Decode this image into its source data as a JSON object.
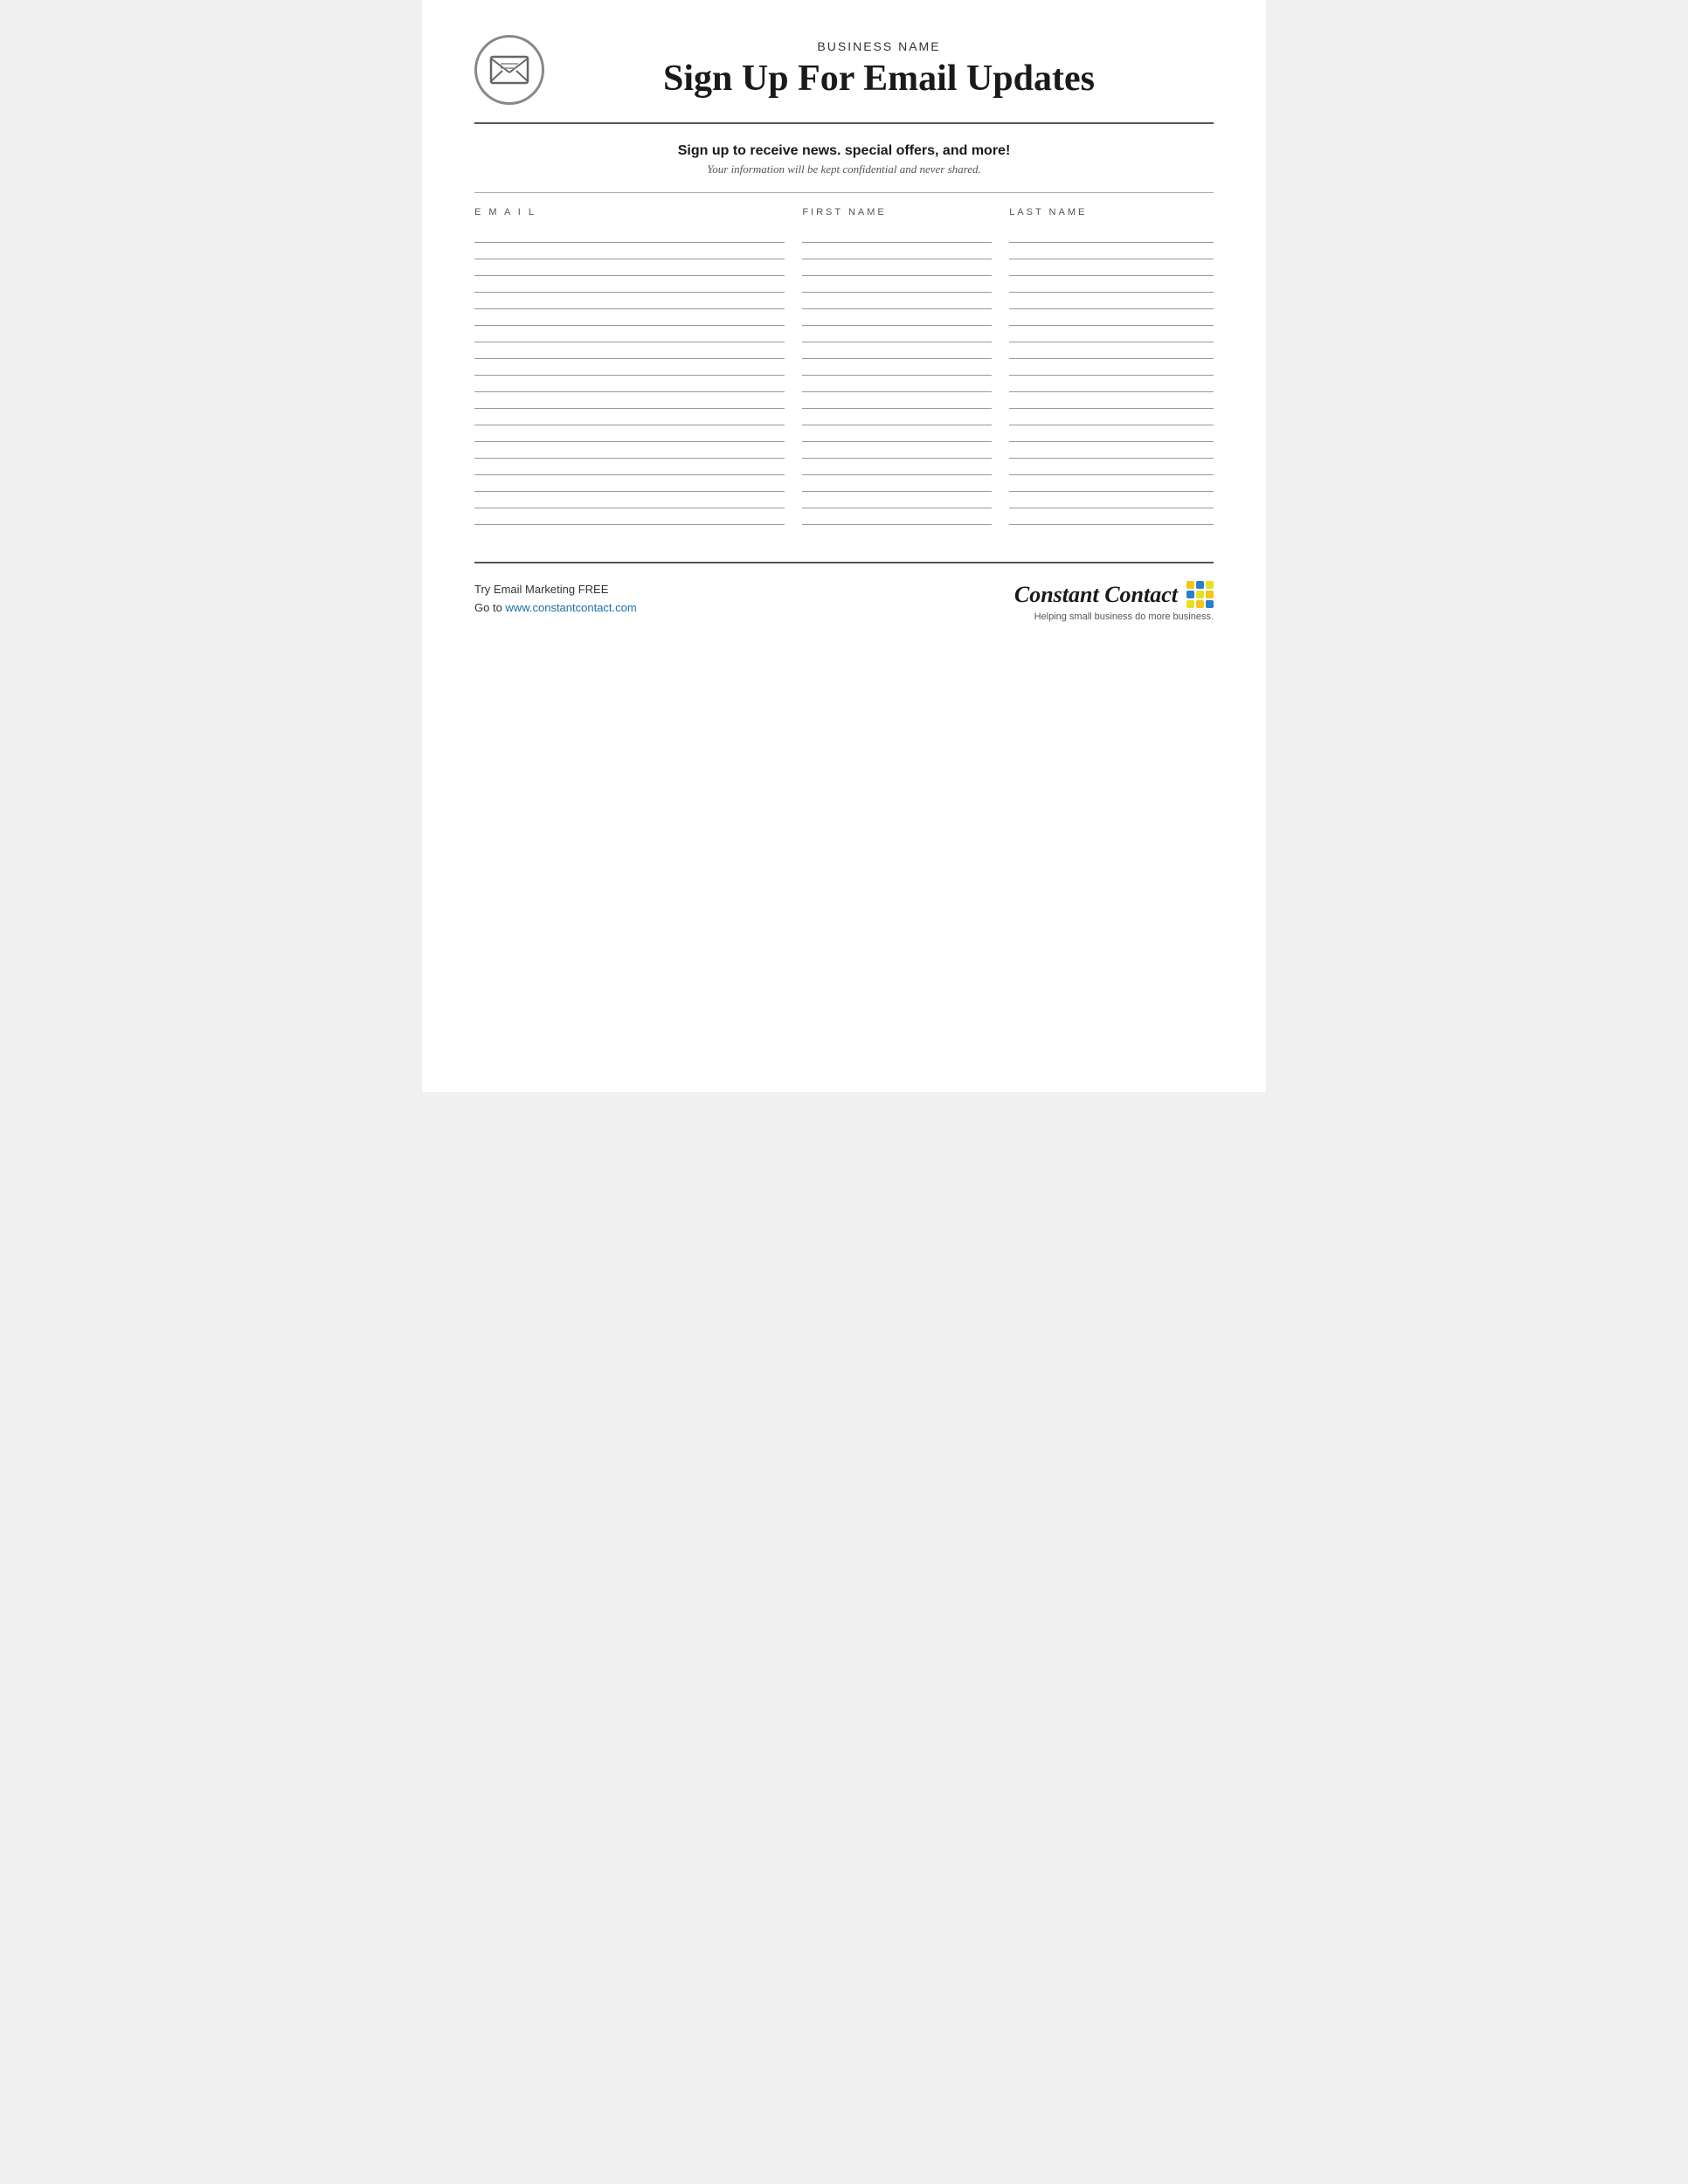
{
  "header": {
    "business_name": "BUSINESS NAME",
    "main_title": "Sign Up For Email Updates",
    "logo_alt": "email-envelope-icon"
  },
  "subheader": {
    "bold_text": "Sign up to receive news. special offers, and more!",
    "italic_text": "Your information will be kept confidential and never shared."
  },
  "columns": {
    "email": "E M A I L",
    "first_name": "FIRST NAME",
    "last_name": "LAST NAME"
  },
  "num_rows": 18,
  "footer": {
    "line1": "Try Email Marketing FREE",
    "line2_prefix": "Go to ",
    "link_text": "www.constantcontact.com",
    "link_href": "http://www.constantcontact.com",
    "cc_logo_text": "Constant Contact",
    "cc_tagline": "Helping small business do more business."
  }
}
